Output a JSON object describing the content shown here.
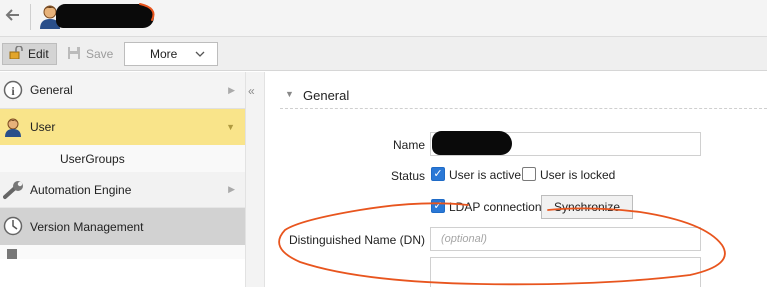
{
  "toolbar": {
    "edit_label": "Edit",
    "save_label": "Save",
    "more_label": "More"
  },
  "sidebar": {
    "items": [
      {
        "label": "General",
        "icon": "info-icon"
      },
      {
        "label": "User",
        "icon": "user-icon",
        "selected": true
      },
      {
        "label": "UserGroups"
      },
      {
        "label": "Automation Engine",
        "icon": "wrench-icon"
      },
      {
        "label": "Version Management",
        "icon": "clock-icon"
      }
    ]
  },
  "main": {
    "section_title": "General",
    "name_label": "Name",
    "status_label": "Status",
    "user_active_label": "User is active",
    "user_active_checked": true,
    "user_locked_label": "User is locked",
    "user_locked_checked": false,
    "ldap_label": "LDAP connection",
    "ldap_checked": true,
    "synchronize_label": "Synchronize",
    "dn_label": "Distinguished Name (DN)",
    "dn_placeholder": "(optional)"
  },
  "colors": {
    "selected_nav": "#f9e48a",
    "checkbox_blue": "#2a78d6",
    "annotation_orange": "#e8551e"
  }
}
